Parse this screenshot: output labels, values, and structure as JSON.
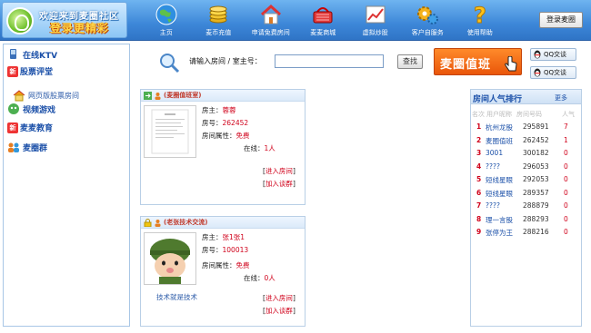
{
  "header": {
    "logo_line1": "欢迎来到麦圈社区",
    "logo_line2": "登录更精彩",
    "login_button": "登录麦圈",
    "nav": [
      {
        "label": "主页",
        "icon": "globe-icon"
      },
      {
        "label": "麦币充值",
        "icon": "coins-icon"
      },
      {
        "label": "申请免费房间",
        "icon": "house-icon"
      },
      {
        "label": "麦麦商城",
        "icon": "shopping-basket-icon"
      },
      {
        "label": "虚拟炒股",
        "icon": "stock-chart-icon"
      },
      {
        "label": "客户自服务",
        "icon": "gear-icon"
      },
      {
        "label": "使用帮助",
        "icon": "question-icon"
      }
    ]
  },
  "sidebar": {
    "items": [
      {
        "label": "在线KTV",
        "icon": "microphone-icon",
        "new": false
      },
      {
        "label": "股票评堂",
        "icon": "new-badge",
        "new": true,
        "new_text": "新"
      },
      {
        "label": "网页版股票房间",
        "icon": "home-icon",
        "sub": true
      },
      {
        "label": "视频游戏",
        "icon": "game-icon",
        "new": false
      },
      {
        "label": "麦麦教育",
        "icon": "new-badge",
        "new": true,
        "new_text": "新"
      },
      {
        "label": "麦圈群",
        "icon": "group-icon",
        "new": false
      }
    ]
  },
  "search": {
    "label": "请输入房间 / 室主号：",
    "input_value": "",
    "button": "查找"
  },
  "rooms": [
    {
      "title": "(麦圈值班室)",
      "owner_label": "房主：",
      "owner": "蓉蓉",
      "room_no_label": "房号：",
      "room_no": "262452",
      "attr_label": "房间属性：",
      "attr": "免费",
      "online_label": "在线：",
      "online": "1人",
      "enter": "进入房间",
      "fav": "加入谈群",
      "desc": ""
    },
    {
      "title": "(老张技术交流)",
      "owner_label": "房主：",
      "owner": "张1张1",
      "room_no_label": "房号：",
      "room_no": "100013",
      "attr_label": "房间属性：",
      "attr": "免费",
      "online_label": "在线：",
      "online": "0人",
      "enter": "进入房间",
      "fav": "加入谈群",
      "desc": "技术就是技术"
    }
  ],
  "banner": {
    "text": "麦圈值班"
  },
  "qq": [
    {
      "label": "QQ交谈"
    },
    {
      "label": "QQ交谈"
    }
  ],
  "ranking": {
    "title": "房间人气排行",
    "more": "更多",
    "columns": {
      "rank": "名次",
      "name": "用户昵称",
      "room": "房间号码",
      "pop": "人气"
    },
    "rows": [
      {
        "rank": "1",
        "name": "杭州龙股",
        "room": "295891",
        "pop": "7"
      },
      {
        "rank": "2",
        "name": "麦圈值班",
        "room": "262452",
        "pop": "1"
      },
      {
        "rank": "3",
        "name": "3001",
        "room": "300182",
        "pop": "0"
      },
      {
        "rank": "4",
        "name": "????",
        "room": "296053",
        "pop": "0"
      },
      {
        "rank": "5",
        "name": "短线星眼",
        "room": "292053",
        "pop": "0"
      },
      {
        "rank": "6",
        "name": "短线星眼",
        "room": "289357",
        "pop": "0"
      },
      {
        "rank": "7",
        "name": "????",
        "room": "288879",
        "pop": "0"
      },
      {
        "rank": "8",
        "name": "理一言股",
        "room": "288293",
        "pop": "0"
      },
      {
        "rank": "9",
        "name": "张停为王",
        "room": "288216",
        "pop": "0"
      }
    ]
  },
  "colors": {
    "header_blue": "#3d87d8",
    "accent_red": "#d0021b",
    "link_blue": "#1a4fa8",
    "banner_orange": "#e9560a"
  }
}
